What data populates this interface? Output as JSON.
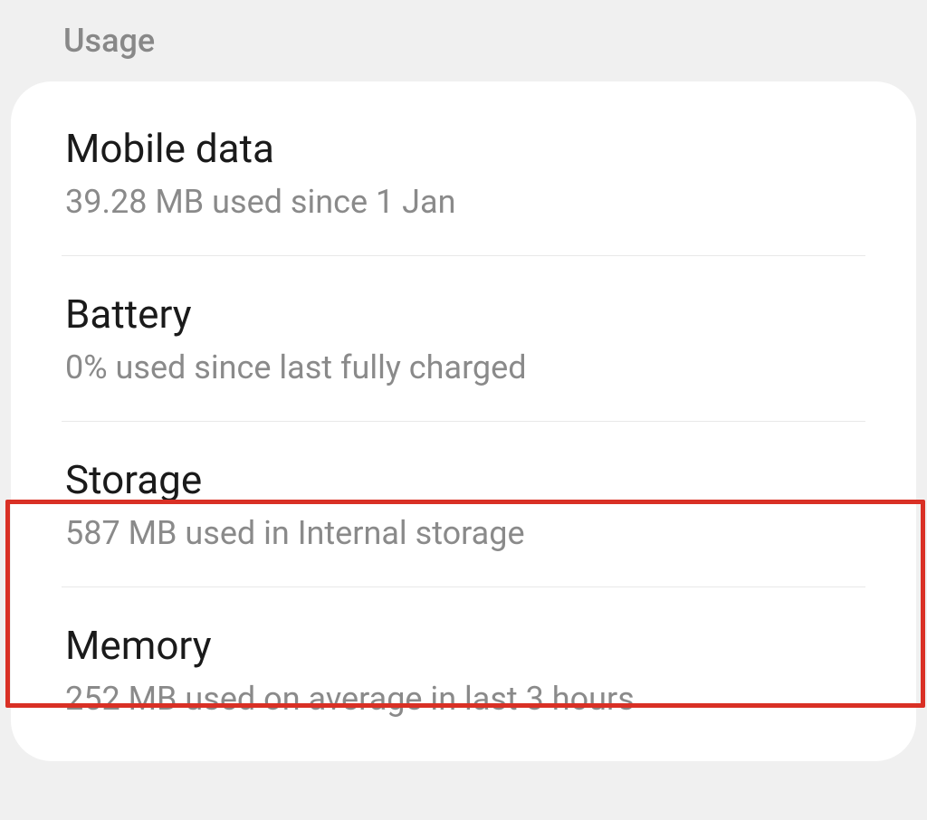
{
  "section": {
    "title": "Usage"
  },
  "items": [
    {
      "title": "Mobile data",
      "subtitle": "39.28 MB used since 1 Jan"
    },
    {
      "title": "Battery",
      "subtitle": "0% used since last fully charged"
    },
    {
      "title": "Storage",
      "subtitle": "587 MB used in Internal storage"
    },
    {
      "title": "Memory",
      "subtitle": "252 MB used on average in last 3 hours"
    }
  ]
}
